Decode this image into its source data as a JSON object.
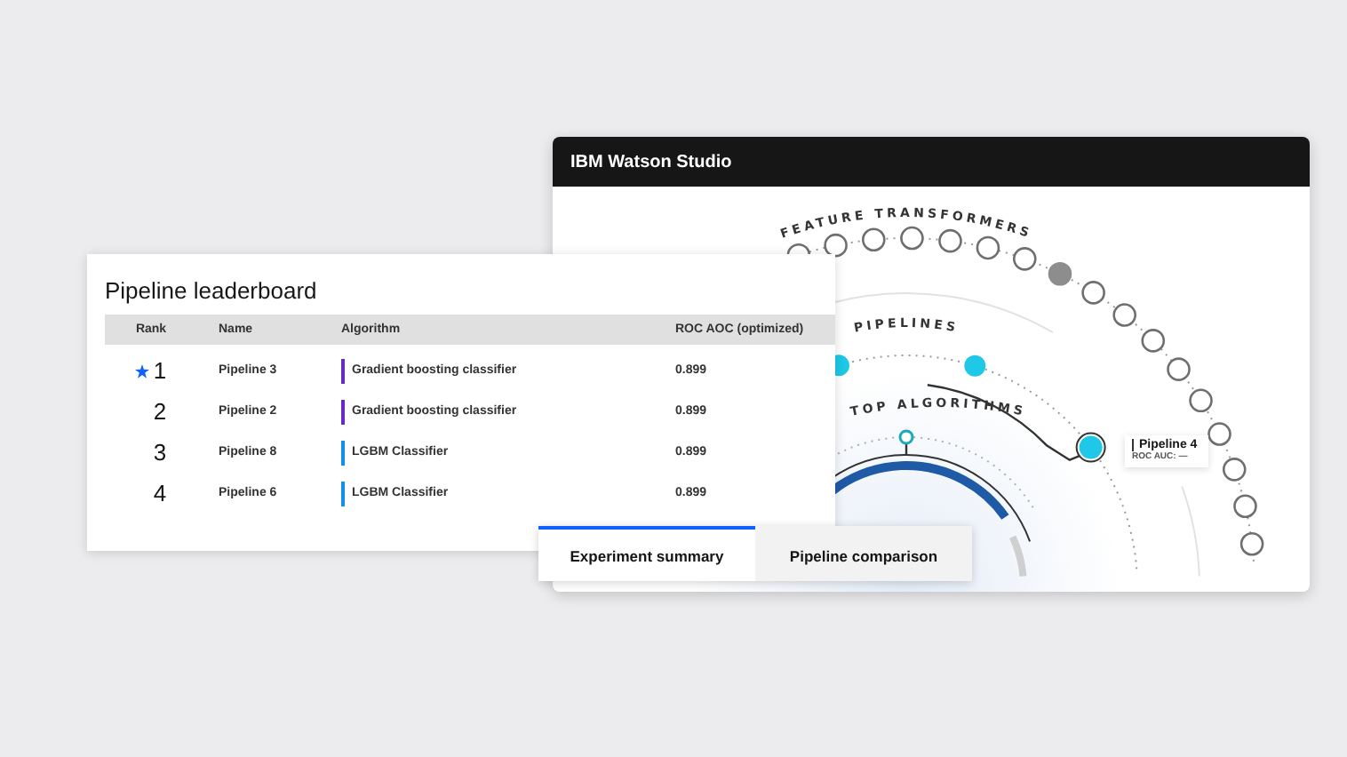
{
  "studio_window": {
    "title": "IBM Watson Studio",
    "diagram": {
      "feature_label": "FEATURE TRANSFORMERS",
      "pipelines_label": "PIPELINES",
      "algorithms_label": "TOP ALGORITHMS",
      "feature_nodes": [
        {
          "filled": false
        },
        {
          "filled": false
        },
        {
          "filled": false
        },
        {
          "filled": false
        },
        {
          "filled": false
        },
        {
          "filled": false
        },
        {
          "filled": false
        },
        {
          "filled": true
        },
        {
          "filled": false
        },
        {
          "filled": false
        },
        {
          "filled": false
        },
        {
          "filled": false
        },
        {
          "filled": false
        },
        {
          "filled": false
        },
        {
          "filled": false
        },
        {
          "filled": false
        },
        {
          "filled": false
        }
      ],
      "callout": {
        "title": "Pipeline 4",
        "subtitle": "ROC AUC: —"
      }
    }
  },
  "leaderboard": {
    "title": "Pipeline leaderboard",
    "columns": [
      "Rank",
      "Name",
      "Algorithm",
      "ROC AOC (optimized)"
    ],
    "rows": [
      {
        "rank": "1",
        "starred": true,
        "name": "Pipeline 3",
        "algorithm": "Gradient boosting classifier",
        "color": "#6929c4",
        "score": "0.899"
      },
      {
        "rank": "2",
        "starred": false,
        "name": "Pipeline 2",
        "algorithm": "Gradient boosting classifier",
        "color": "#6929c4",
        "score": "0.899"
      },
      {
        "rank": "3",
        "starred": false,
        "name": "Pipeline 8",
        "algorithm": "LGBM Classifier",
        "color": "#1192e8",
        "score": "0.899"
      },
      {
        "rank": "4",
        "starred": false,
        "name": "Pipeline 6",
        "algorithm": "LGBM Classifier",
        "color": "#1192e8",
        "score": "0.899"
      }
    ]
  },
  "tabs": [
    {
      "label": "Experiment summary",
      "selected": true
    },
    {
      "label": "Pipeline comparison",
      "selected": false
    }
  ]
}
